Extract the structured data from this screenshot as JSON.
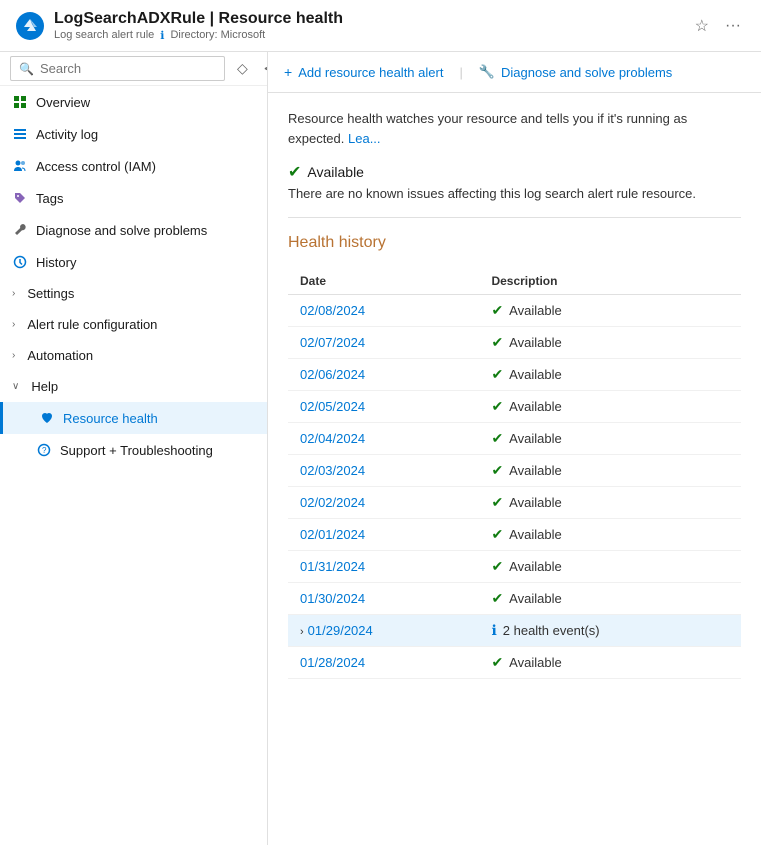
{
  "header": {
    "logo_alt": "Azure logo",
    "resource_name": "LogSearchADXRule",
    "separator": "|",
    "page_title": "Resource health",
    "subtitle_type": "Log search alert rule",
    "subtitle_icon": "ℹ",
    "subtitle_dir": "Directory: Microsoft"
  },
  "toolbar": {
    "add_alert_icon": "+",
    "add_alert_label": "Add resource health alert",
    "diagnose_icon": "🔧",
    "diagnose_label": "Diagnose and solve problems"
  },
  "info_banner": {
    "text": "Resource health watches your resource and tells you if it's running as expected.",
    "link_text": "Lea..."
  },
  "status": {
    "icon": "✔",
    "label": "Available",
    "description": "There are no known issues affecting this log search alert rule resource."
  },
  "health_history": {
    "section_title": "Health history",
    "columns": [
      {
        "key": "date",
        "label": "Date"
      },
      {
        "key": "description",
        "label": "Description"
      }
    ],
    "rows": [
      {
        "date": "02/08/2024",
        "status": "available",
        "label": "Available",
        "expanded": false,
        "event_count": null
      },
      {
        "date": "02/07/2024",
        "status": "available",
        "label": "Available",
        "expanded": false,
        "event_count": null
      },
      {
        "date": "02/06/2024",
        "status": "available",
        "label": "Available",
        "expanded": false,
        "event_count": null
      },
      {
        "date": "02/05/2024",
        "status": "available",
        "label": "Available",
        "expanded": false,
        "event_count": null
      },
      {
        "date": "02/04/2024",
        "status": "available",
        "label": "Available",
        "expanded": false,
        "event_count": null
      },
      {
        "date": "02/03/2024",
        "status": "available",
        "label": "Available",
        "expanded": false,
        "event_count": null
      },
      {
        "date": "02/02/2024",
        "status": "available",
        "label": "Available",
        "expanded": false,
        "event_count": null
      },
      {
        "date": "02/01/2024",
        "status": "available",
        "label": "Available",
        "expanded": false,
        "event_count": null
      },
      {
        "date": "01/31/2024",
        "status": "available",
        "label": "Available",
        "expanded": false,
        "event_count": null
      },
      {
        "date": "01/30/2024",
        "status": "available",
        "label": "Available",
        "expanded": false,
        "event_count": null
      },
      {
        "date": "01/29/2024",
        "status": "events",
        "label": "2 health event(s)",
        "expanded": true,
        "event_count": 2
      },
      {
        "date": "01/28/2024",
        "status": "available",
        "label": "Available",
        "expanded": false,
        "event_count": null
      }
    ]
  },
  "sidebar": {
    "search_placeholder": "Search",
    "items": [
      {
        "id": "overview",
        "label": "Overview",
        "icon": "grid",
        "level": 0,
        "expandable": false,
        "active": false
      },
      {
        "id": "activity-log",
        "label": "Activity log",
        "icon": "list",
        "level": 0,
        "expandable": false,
        "active": false
      },
      {
        "id": "access-control",
        "label": "Access control (IAM)",
        "icon": "person-group",
        "level": 0,
        "expandable": false,
        "active": false
      },
      {
        "id": "tags",
        "label": "Tags",
        "icon": "tag",
        "level": 0,
        "expandable": false,
        "active": false
      },
      {
        "id": "diagnose",
        "label": "Diagnose and solve problems",
        "icon": "wrench",
        "level": 0,
        "expandable": false,
        "active": false
      },
      {
        "id": "history",
        "label": "History",
        "icon": "clock",
        "level": 0,
        "expandable": false,
        "active": false
      },
      {
        "id": "settings",
        "label": "Settings",
        "icon": "chevron-right",
        "level": 0,
        "expandable": true,
        "active": false
      },
      {
        "id": "alert-rule-config",
        "label": "Alert rule configuration",
        "icon": "chevron-right",
        "level": 0,
        "expandable": true,
        "active": false
      },
      {
        "id": "automation",
        "label": "Automation",
        "icon": "chevron-right",
        "level": 0,
        "expandable": true,
        "active": false
      },
      {
        "id": "help",
        "label": "Help",
        "icon": "chevron-down",
        "level": 0,
        "expandable": true,
        "expanded": true,
        "active": false
      },
      {
        "id": "resource-health",
        "label": "Resource health",
        "icon": "heart",
        "level": 1,
        "expandable": false,
        "active": true
      },
      {
        "id": "support-troubleshooting",
        "label": "Support + Troubleshooting",
        "icon": "question",
        "level": 1,
        "expandable": false,
        "active": false
      }
    ]
  }
}
